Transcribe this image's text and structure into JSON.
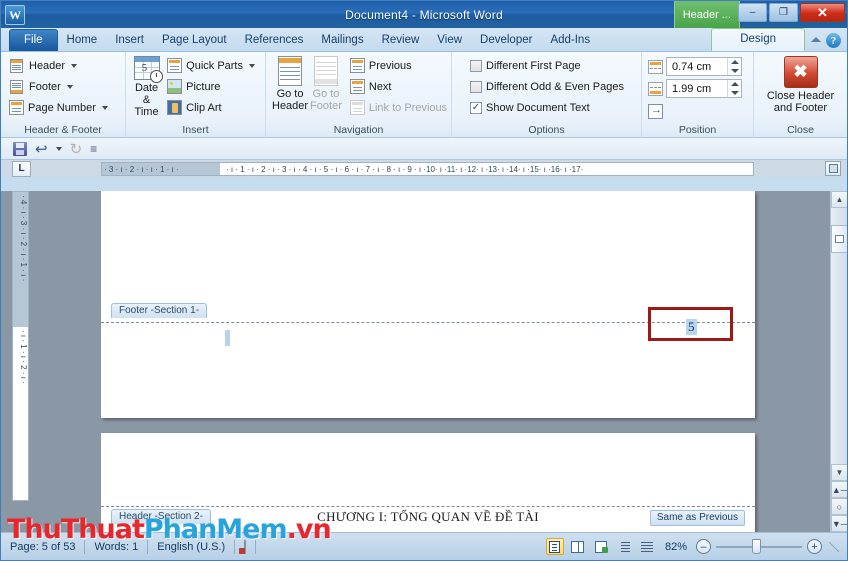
{
  "window": {
    "title": "Document4  -  Microsoft Word",
    "app_logo": "W",
    "contextual_tab_top": "Header ...",
    "minimize": "–",
    "maximize": "❐",
    "close": "✕"
  },
  "tabs": [
    {
      "label": "File"
    },
    {
      "label": "Home"
    },
    {
      "label": "Insert"
    },
    {
      "label": "Page Layout"
    },
    {
      "label": "References"
    },
    {
      "label": "Mailings"
    },
    {
      "label": "Review"
    },
    {
      "label": "View"
    },
    {
      "label": "Developer"
    },
    {
      "label": "Add-Ins"
    }
  ],
  "design_tab": "Design",
  "ribbon": {
    "groups": [
      {
        "name": "Header & Footer",
        "items": [
          {
            "label": "Header",
            "dropdown": true
          },
          {
            "label": "Footer",
            "dropdown": true
          },
          {
            "label": "Page Number",
            "dropdown": true
          }
        ]
      },
      {
        "name": "Insert",
        "date_time": "Date\n& Time",
        "date_label_1": "Date",
        "date_label_2": "& Time",
        "calendar_day": "5",
        "items": [
          {
            "label": "Quick Parts",
            "dropdown": true
          },
          {
            "label": "Picture",
            "dropdown": false
          },
          {
            "label": "Clip Art",
            "dropdown": false
          }
        ]
      },
      {
        "name": "Navigation",
        "go_to_header_1": "Go to",
        "go_to_header_2": "Header",
        "go_to_footer_1": "Go to",
        "go_to_footer_2": "Footer",
        "items": [
          {
            "label": "Previous",
            "disabled": false
          },
          {
            "label": "Next",
            "disabled": false
          },
          {
            "label": "Link to Previous",
            "disabled": true
          }
        ]
      },
      {
        "name": "Options",
        "items": [
          {
            "label": "Different First Page",
            "checked": false
          },
          {
            "label": "Different Odd & Even Pages",
            "checked": false
          },
          {
            "label": "Show Document Text",
            "checked": true
          }
        ]
      },
      {
        "name": "Position",
        "header_from_top": "0.74 cm",
        "footer_from_bottom": "1.99 cm",
        "insert_alignment_tab": "Insert Alignment Tab"
      },
      {
        "name": "Close",
        "close_label_1": "Close Header",
        "close_label_2": "and Footer"
      }
    ]
  },
  "quick_access": {
    "save": "save-icon",
    "undo": "↩",
    "redo": "↻",
    "customize": "≡"
  },
  "ruler": {
    "tab_selector": "L",
    "horizontal_gray_left": "· 3 · ı · 2 · ı · ı · 1 · ı ·",
    "horizontal_white": "· ı · 1 · ı · 2 · ı · 3 · ı · 4 · ı · 5 · ı · 6 · ı · 7 · ı · 8 · ı · 9 · ı ·10· ı ·11· ı ·12· ı ·13· ı ·14· ı ·15· ı ·16· ı ·17·",
    "vertical_top": "· 4 · ı · 3 · ı · 2 · ı · 1 · ı ·",
    "vertical_bottom": "· ı · 1 · ı · 2 · ı ·"
  },
  "document": {
    "footer_section_tag": "Footer -Section 1-",
    "header_section_tag": "Header -Section 2-",
    "same_as_previous": "Same as Previous",
    "page_number_value": "5",
    "chapter_heading": "CHƯƠNG I: TỔNG QUAN VỀ ĐỀ TÀI",
    "highlight_color": "#9e1915"
  },
  "status_bar": {
    "page": "Page: 5 of 53",
    "words": "Words: 1",
    "language": "English (U.S.)",
    "proofing": "proofing-errors-icon",
    "zoom": "82%",
    "view_modes": [
      {
        "name": "print-layout",
        "active": true
      },
      {
        "name": "full-screen-reading",
        "active": false
      },
      {
        "name": "web-layout",
        "active": false
      },
      {
        "name": "outline",
        "active": false
      },
      {
        "name": "draft",
        "active": false
      }
    ],
    "zoom_out": "–",
    "zoom_in": "+"
  },
  "watermark": {
    "part1": "ThuThuat",
    "part2": "PhanMem",
    "part3": ".vn",
    "color1": "#e8262c",
    "color2": "#29a3dc"
  }
}
